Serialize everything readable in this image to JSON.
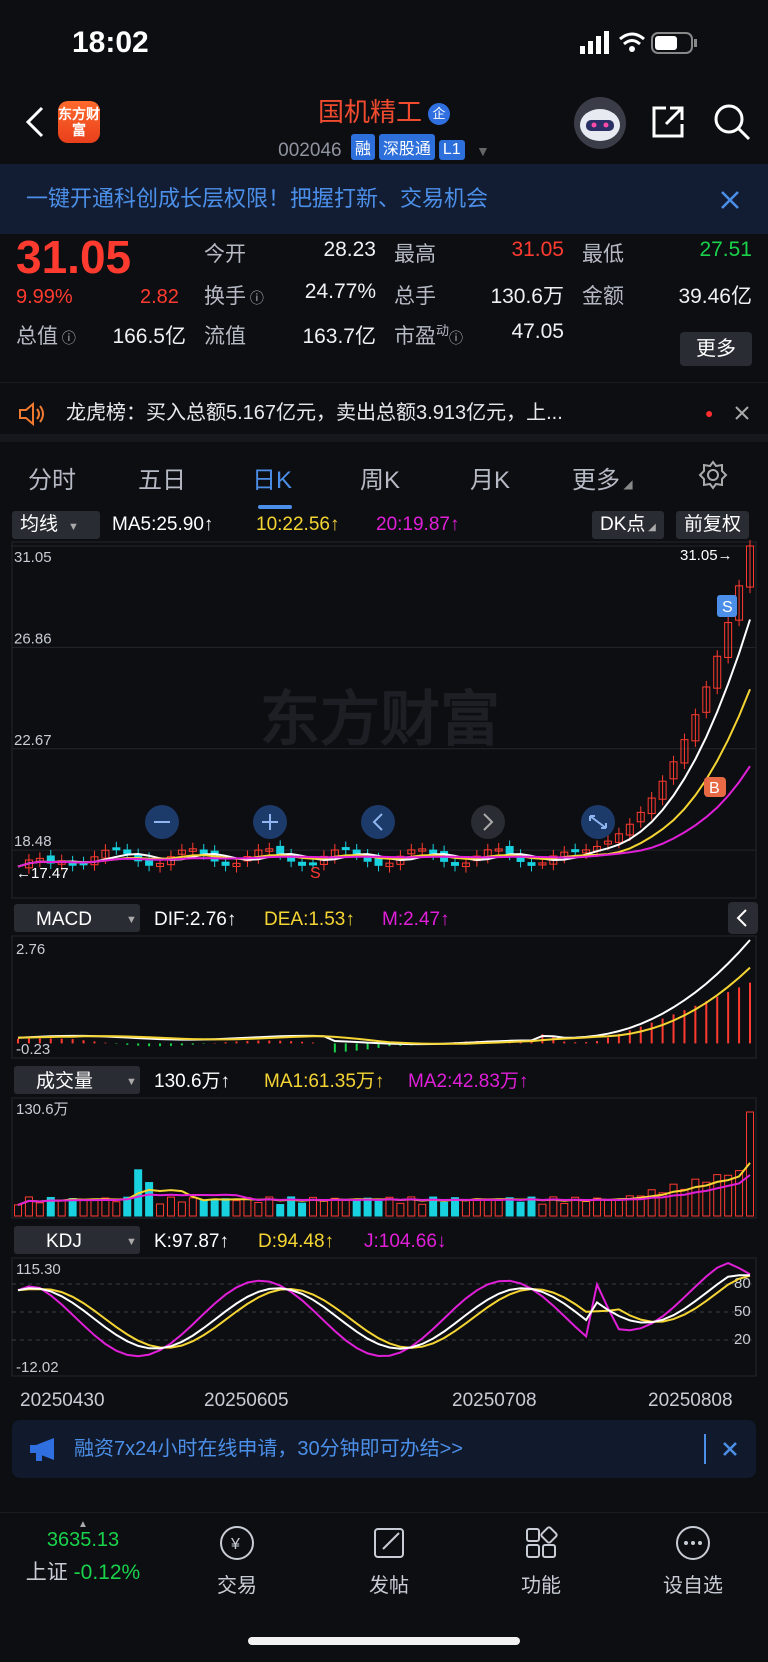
{
  "status_bar": {
    "time": "18:02"
  },
  "header": {
    "logo": "东方财富",
    "stock_name": "国机精工",
    "name_badge": "企",
    "code": "002046",
    "tags": [
      "融",
      "深股通",
      "L1"
    ]
  },
  "banner": {
    "text": "一键开通科创成长层权限！把握打新、交易机会"
  },
  "quote": {
    "price": "31.05",
    "change_pct": "9.99%",
    "change": "2.82",
    "open_label": "今开",
    "open": "28.23",
    "high_label": "最高",
    "high": "31.05",
    "low_label": "最低",
    "low": "27.51",
    "turnover_label": "换手",
    "turnover": "24.77%",
    "volume_label": "总手",
    "volume": "130.6万",
    "amount_label": "金额",
    "amount": "39.46亿",
    "mktcap_label": "总值",
    "mktcap": "166.5亿",
    "float_label": "流值",
    "float": "163.7亿",
    "pe_label": "市盈",
    "pe_sup": "动",
    "pe": "47.05",
    "more": "更多"
  },
  "news": {
    "text": "龙虎榜：买入总额5.167亿元，卖出总额3.913亿元，上..."
  },
  "tabs": [
    "分时",
    "五日",
    "日K",
    "周K",
    "月K",
    "更多"
  ],
  "chart": {
    "ma_selector": "均线",
    "ma5": "MA5:25.90↑",
    "ma10": "10:22.56↑",
    "ma20": "20:19.87↑",
    "dk_btn": "DK点",
    "adj_btn": "前复权",
    "price_ticks": [
      "31.05",
      "26.86",
      "22.67",
      "18.48"
    ],
    "price_last_label": "31.05→",
    "low_label": "←17.47",
    "watermark": "东方财富",
    "macd_selector": "MACD",
    "dif": "DIF:2.76↑",
    "dea": "DEA:1.53↑",
    "m": "M:2.47↑",
    "macd_top": "2.76",
    "macd_bottom": "-0.23",
    "vol_selector": "成交量",
    "vol": "130.6万↑",
    "vol_ma1": "MA1:61.35万↑",
    "vol_ma2": "MA2:42.83万↑",
    "vol_top": "130.6万",
    "kdj_selector": "KDJ",
    "k": "K:97.87↑",
    "d": "D:94.48↑",
    "j": "J:104.66↓",
    "kdj_top": "115.30",
    "kdj_bottom": "-12.02",
    "kdj_levels": [
      "80",
      "50",
      "20"
    ],
    "dates": [
      "20250430",
      "20250605",
      "20250708",
      "20250808"
    ]
  },
  "chart_data": {
    "type": "candlestick",
    "title": "国机精工 002046 日K",
    "price_ylim": [
      17.0,
      31.05
    ],
    "price_ticks": [
      31.05,
      26.86,
      22.67,
      18.48
    ],
    "dates": [
      "20250430",
      "20250605",
      "20250708",
      "20250808"
    ],
    "last_close": 31.05,
    "ma": {
      "MA5": 25.9,
      "MA10": 22.56,
      "MA20": 19.87
    },
    "macd": {
      "DIF": 2.76,
      "DEA": 1.53,
      "M": 2.47,
      "range": [
        -0.23,
        2.76
      ]
    },
    "volume": {
      "last": "130.6万",
      "MA1": "61.35万",
      "MA2": "42.83万"
    },
    "kdj": {
      "K": 97.87,
      "D": 94.48,
      "J": 104.66,
      "range": [
        -12.02,
        115.3
      ]
    },
    "colors": {
      "up": "#ff3b30",
      "down": "#19d2e0",
      "ma5": "#ffffff",
      "ma10": "#f5d533",
      "ma20": "#e01fd8"
    }
  },
  "bottom_banner": {
    "text": "融资7x24小时在线申请，30分钟即可办结>>"
  },
  "bottom_nav": {
    "index_value": "3635.13",
    "index_name": "上证",
    "index_change": "-0.12%",
    "items": [
      "交易",
      "发帖",
      "功能",
      "设自选"
    ]
  }
}
